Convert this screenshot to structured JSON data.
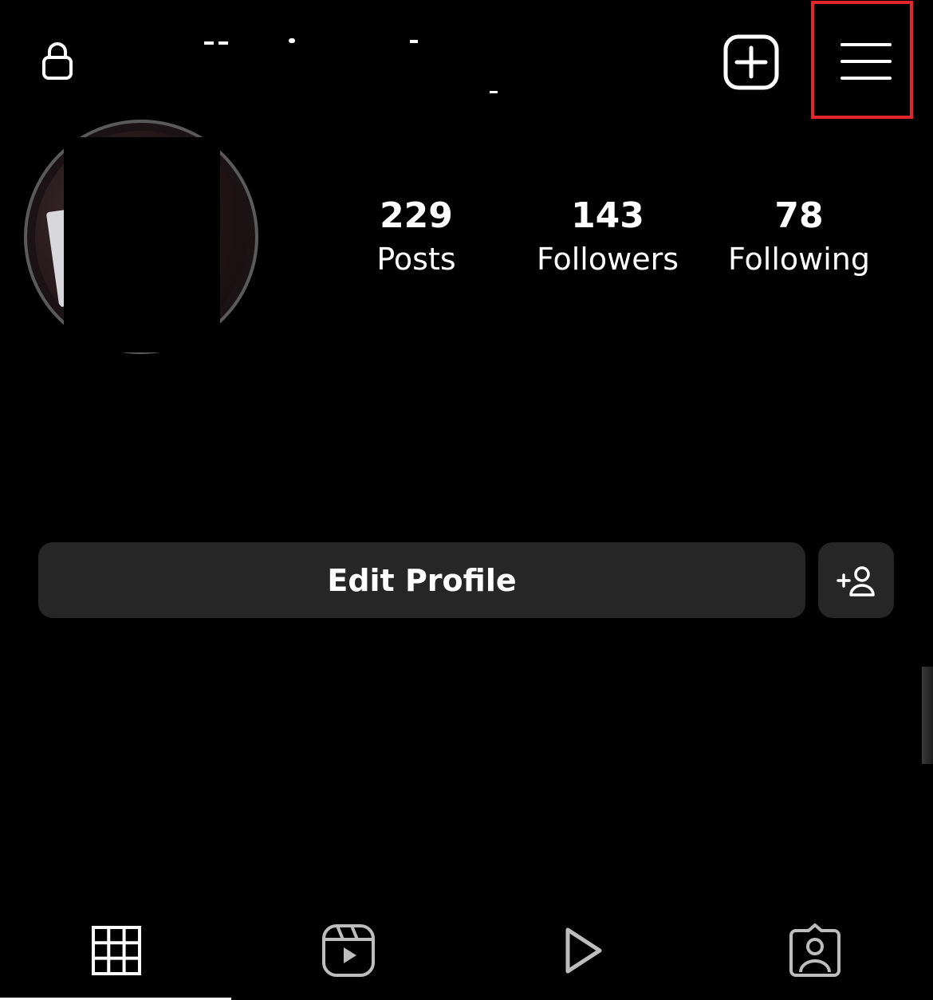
{
  "header": {
    "lock_icon": "lock-icon",
    "create_icon": "plus-square-icon",
    "menu_icon": "hamburger-menu-icon",
    "highlight_color": "#e3262d"
  },
  "profile": {
    "avatar_icon": "profile-avatar"
  },
  "stats": {
    "posts": {
      "count": "229",
      "label": "Posts"
    },
    "followers": {
      "count": "143",
      "label": "Followers"
    },
    "following": {
      "count": "78",
      "label": "Following"
    }
  },
  "actions": {
    "edit_profile_label": "Edit Profile",
    "add_user_icon": "add-person-icon"
  },
  "tabs": [
    {
      "icon": "grid-icon",
      "active": true
    },
    {
      "icon": "reels-icon",
      "active": false
    },
    {
      "icon": "play-icon",
      "active": false
    },
    {
      "icon": "tagged-person-icon",
      "active": false
    }
  ]
}
